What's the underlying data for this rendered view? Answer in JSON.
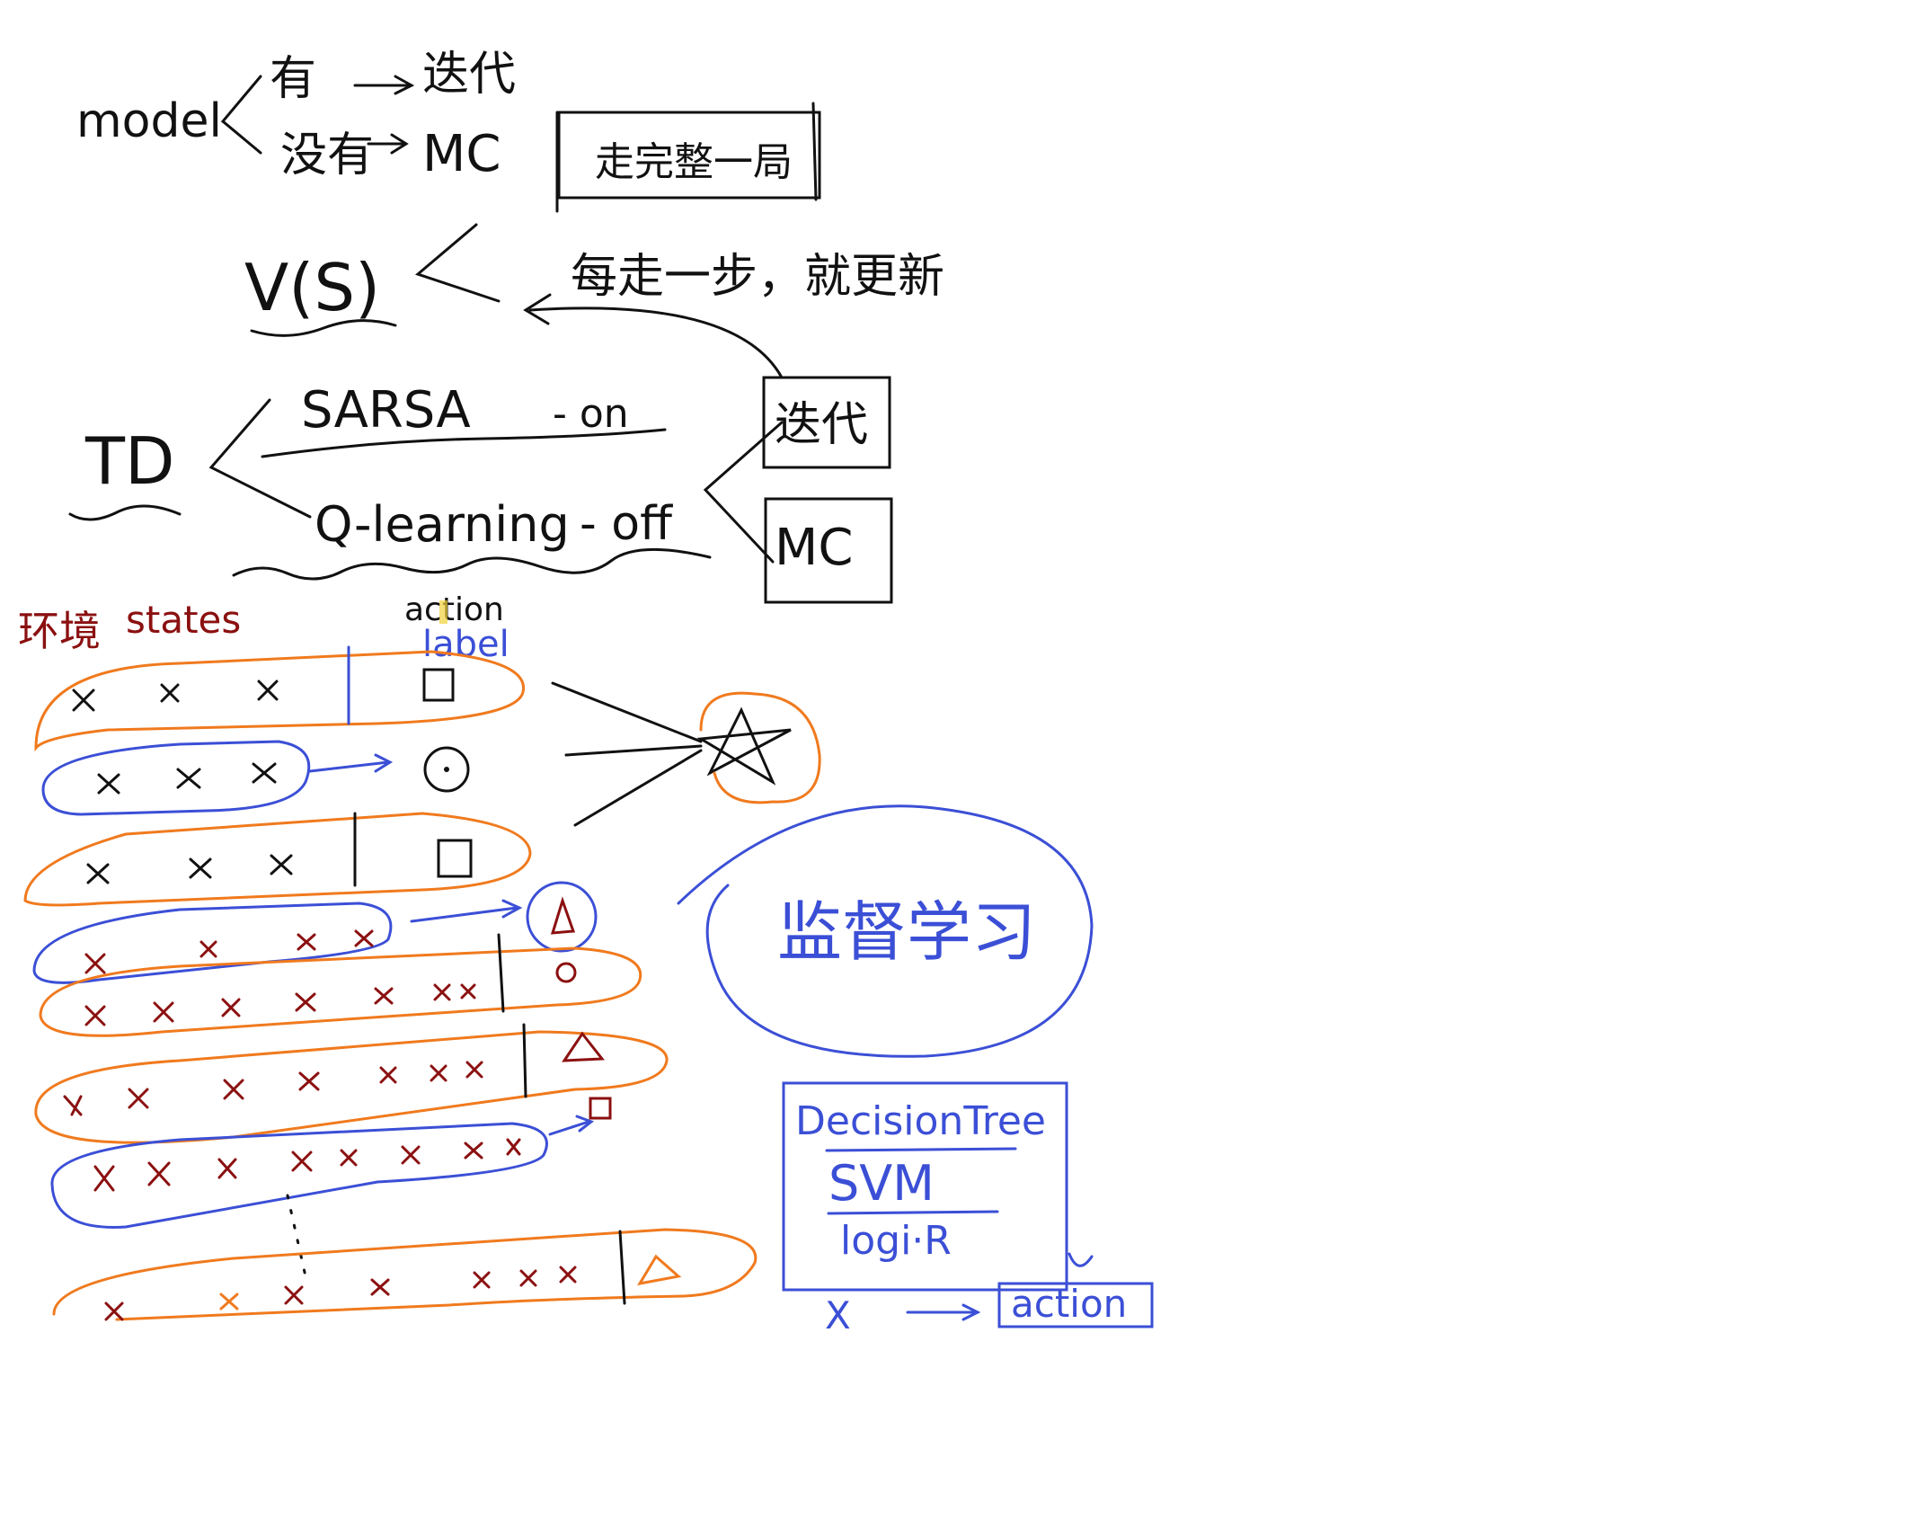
{
  "colors": {
    "ink": "#111111",
    "orange": "#f07a1e",
    "blue": "#3b4fd6",
    "darkred": "#8b1010",
    "highlight": "#f2d23c"
  },
  "model_branch": {
    "root": "model",
    "with_model": "有",
    "with_model_method": "迭代",
    "without_model": "没有",
    "without_model_method": "MC",
    "boxed_note": "走完整一局"
  },
  "value_fn": {
    "label": "V(S)",
    "update_note": "每走一步，就更新"
  },
  "td_branch": {
    "root": "TD",
    "sarsa": "SARSA",
    "sarsa_policy": "- on",
    "qlearning": "Q-learning",
    "qlearning_policy": "- off",
    "iter_box": "迭代",
    "mc_box": "MC"
  },
  "data_section": {
    "states_prefix": "环境",
    "states_label": "states",
    "action_label": "action",
    "label_label": "label"
  },
  "supervised": {
    "label": "监督学习"
  },
  "models_box": {
    "items": [
      "DecisionTree",
      "SVM",
      "logi·R"
    ],
    "input": "X",
    "output": "action"
  }
}
